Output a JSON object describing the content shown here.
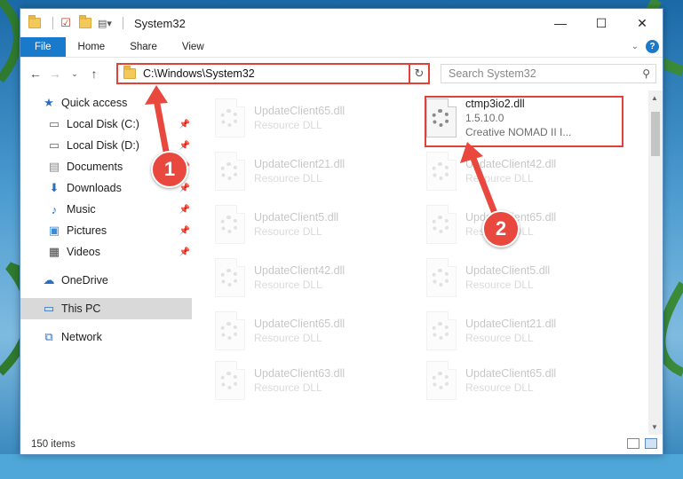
{
  "window": {
    "title": "System32"
  },
  "window_controls": {
    "minimize": "—",
    "maximize": "☐",
    "close": "✕"
  },
  "ribbon": {
    "tabs": [
      "File",
      "Home",
      "Share",
      "View"
    ]
  },
  "nav": {
    "address": "C:\\Windows\\System32",
    "search_placeholder": "Search System32"
  },
  "sidebar": {
    "items": [
      {
        "label": "Quick access",
        "icon": "star-icon"
      },
      {
        "label": "Local Disk (C:)",
        "icon": "drive-icon",
        "pinned": true
      },
      {
        "label": "Local Disk (D:)",
        "icon": "drive-icon",
        "pinned": true
      },
      {
        "label": "Documents",
        "icon": "documents-icon",
        "pinned": true
      },
      {
        "label": "Downloads",
        "icon": "download-icon",
        "pinned": true
      },
      {
        "label": "Music",
        "icon": "music-icon",
        "pinned": true
      },
      {
        "label": "Pictures",
        "icon": "pictures-icon",
        "pinned": true
      },
      {
        "label": "Videos",
        "icon": "videos-icon",
        "pinned": true
      },
      {
        "label": "OneDrive",
        "icon": "cloud-icon"
      },
      {
        "label": "This PC",
        "icon": "computer-icon",
        "selected": true
      },
      {
        "label": "Network",
        "icon": "network-icon"
      }
    ]
  },
  "files": [
    {
      "name": "UpdateClient65.dll",
      "sub": "Resource DLL"
    },
    {
      "name": "ctmp3io2.dll",
      "sub": "1.5.10.0",
      "sub2": "Creative NOMAD II I...",
      "highlighted": true
    },
    {
      "name": "UpdateClient21.dll",
      "sub": "Resource DLL"
    },
    {
      "name": "UpdateClient42.dll",
      "sub": "Resource DLL"
    },
    {
      "name": "UpdateClient5.dll",
      "sub": "Resource DLL"
    },
    {
      "name": "UpdateClient65.dll",
      "sub": "Resource DLL"
    },
    {
      "name": "UpdateClient42.dll",
      "sub": "Resource DLL"
    },
    {
      "name": "UpdateClient5.dll",
      "sub": "Resource DLL"
    },
    {
      "name": "UpdateClient65.dll",
      "sub": "Resource DLL"
    },
    {
      "name": "UpdateClient21.dll",
      "sub": "Resource DLL"
    },
    {
      "name": "UpdateClient63.dll",
      "sub": "Resource DLL"
    },
    {
      "name": "UpdateClient65.dll",
      "sub": "Resource DLL"
    }
  ],
  "status": {
    "items_count": "150 items"
  },
  "annotations": {
    "step1": "1",
    "step2": "2",
    "highlight_color": "#e0423a"
  }
}
